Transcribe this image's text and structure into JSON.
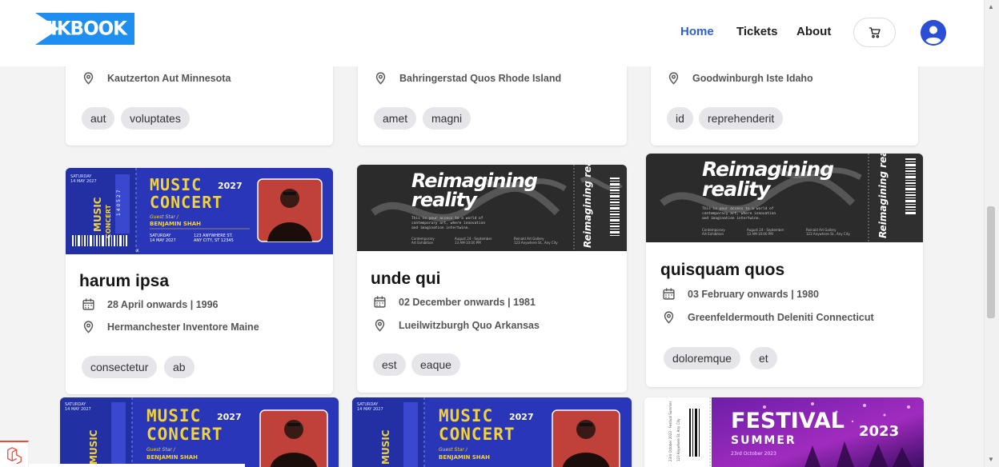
{
  "brand": {
    "name": "TIKBOOK",
    "color": "#1e8ff0"
  },
  "nav": {
    "links": [
      {
        "label": "Home",
        "active": true
      },
      {
        "label": "Tickets",
        "active": false
      },
      {
        "label": "About",
        "active": false
      }
    ]
  },
  "icons": {
    "cart": "cart-icon",
    "user": "user-avatar-icon",
    "calendar": "calendar-icon",
    "location": "location-pin-icon"
  },
  "colors": {
    "accent": "#2f5fd6",
    "tag_bg": "#e6e6ea",
    "page_bg": "#f3f3f3"
  },
  "events": [
    {
      "title": "",
      "date": "",
      "location": "Kautzerton Aut Minnesota",
      "tags": [
        "aut",
        "voluptates"
      ]
    },
    {
      "title": "",
      "date": "",
      "location": "Bahringerstad Quos Rhode Island",
      "tags": [
        "amet",
        "magni"
      ]
    },
    {
      "title": "",
      "date": "",
      "location": "Goodwinburgh Iste Idaho",
      "tags": [
        "id",
        "reprehenderit"
      ]
    },
    {
      "title": "harum ipsa",
      "date": "28 April onwards | 1996",
      "location": "Hermanchester Inventore Maine",
      "tags": [
        "consectetur",
        "ab"
      ]
    },
    {
      "title": "unde qui",
      "date": "02 December onwards | 1981",
      "location": "Lueilwitzburgh Quo Arkansas",
      "tags": [
        "est",
        "eaque"
      ]
    },
    {
      "title": "quisquam quos",
      "date": "03 February onwards | 1980",
      "location": "Greenfeldermouth Deleniti Connecticut",
      "tags": [
        "doloremque",
        "et"
      ]
    }
  ],
  "posters": {
    "concert": {
      "top_left": "SATURDAY\n14 MAY 2027",
      "title_line1": "MUSIC",
      "title_line2": "CONCERT",
      "year": "2027",
      "guest_label": "Guest Star /",
      "guest_name": "BENJAMIN SHAH",
      "date_line": "SATURDAY\n14 MAY 2027",
      "address": "123 ANYWHERE ST.\nANY CITY, ST 12345",
      "side_text": "MUSIC CONCERT"
    },
    "reimagining": {
      "title_line1": "Reimagining",
      "title_line2": "reality",
      "blurb": "This is your access to a world of\ncontemporary art, where innovation\nand imagination intertwine.",
      "col1": "Contemporary\nArt Exhibition",
      "col2": "August 24 - September\n13 AM-10:00 PM",
      "col3": "Reinald Art Gallery\n123 Anywhere St., Any City",
      "stub": "Reimagining reality",
      "stub_small": "Ticket No. 012"
    },
    "festival": {
      "title": "FESTIVAL",
      "subtitle": "SUMMER",
      "year": "2023",
      "date": "23rd October 2023"
    }
  }
}
